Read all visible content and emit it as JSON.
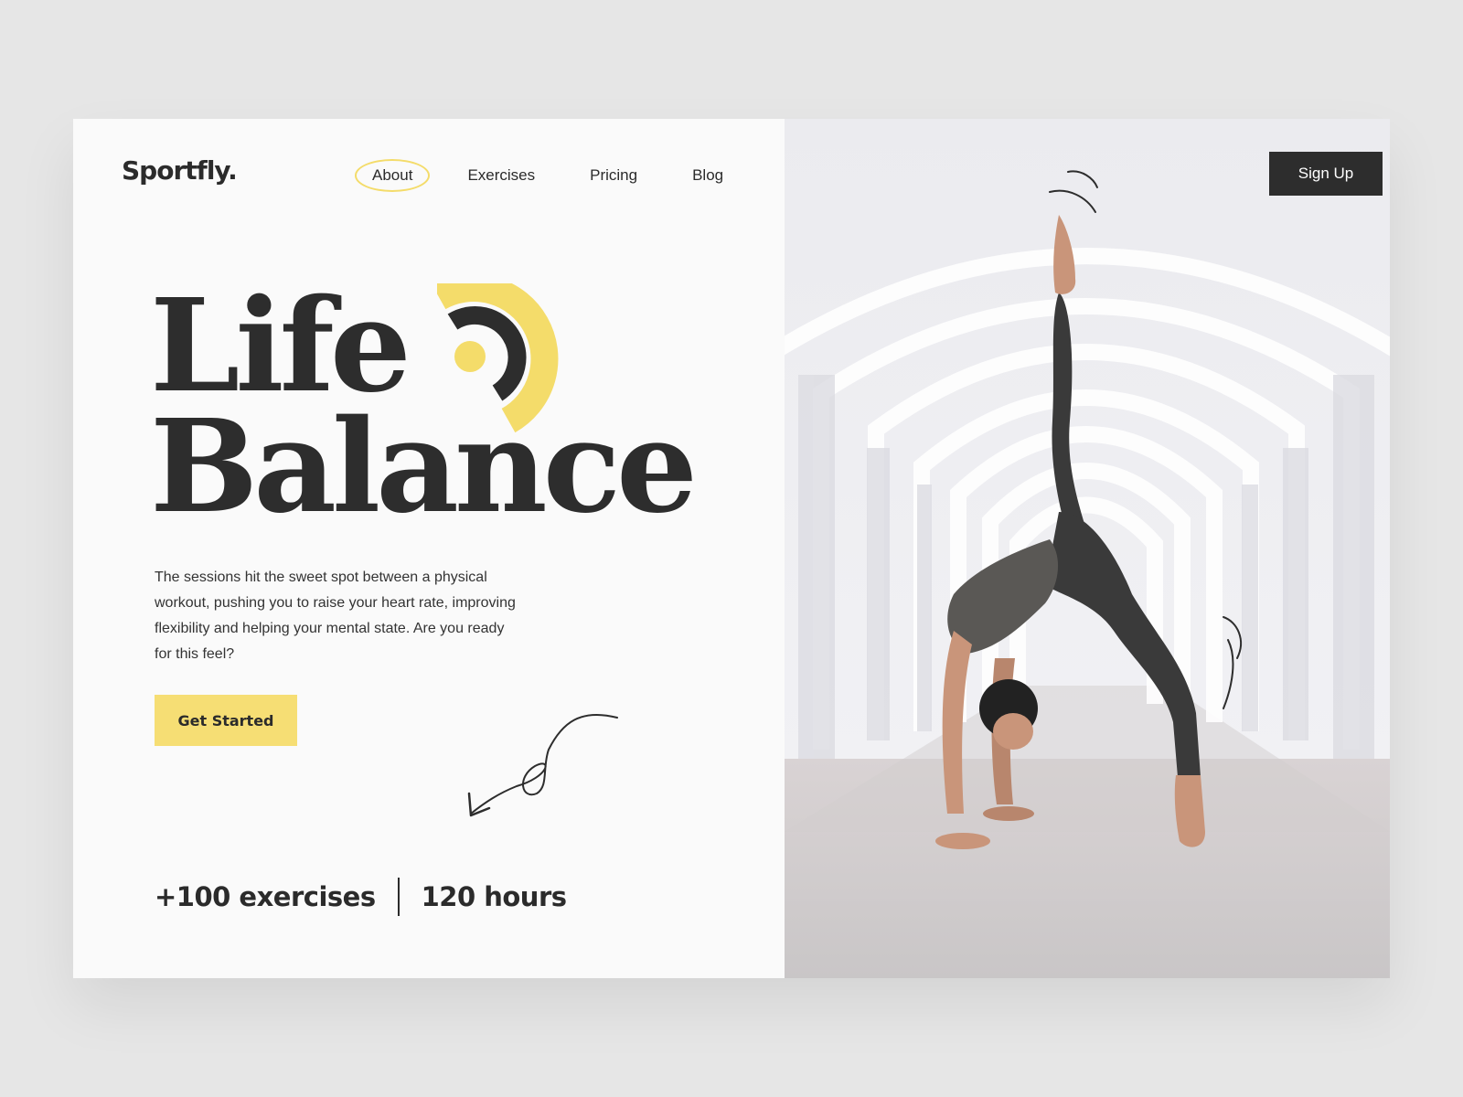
{
  "brand": {
    "logo": "Sportfly."
  },
  "nav": {
    "items": [
      {
        "label": "About",
        "active": true
      },
      {
        "label": "Exercises",
        "active": false
      },
      {
        "label": "Pricing",
        "active": false
      },
      {
        "label": "Blog",
        "active": false
      }
    ]
  },
  "header": {
    "signup_label": "Sign Up"
  },
  "hero": {
    "title_line1": "Life",
    "title_line2": "Balance",
    "description": "The sessions hit the sweet spot between a physical workout, pushing you to raise your heart rate, improving flexibility and helping your mental state. Are you ready for this feel?",
    "cta_label": "Get Started"
  },
  "stats": {
    "exercises": "+100 exercises",
    "hours": "120 hours"
  },
  "colors": {
    "accent": "#f6de74",
    "dark": "#2d2d2d",
    "background": "#fafafa"
  },
  "icons": [
    "logo-mark-icon",
    "curved-arrow-icon",
    "motion-lines-icon"
  ]
}
